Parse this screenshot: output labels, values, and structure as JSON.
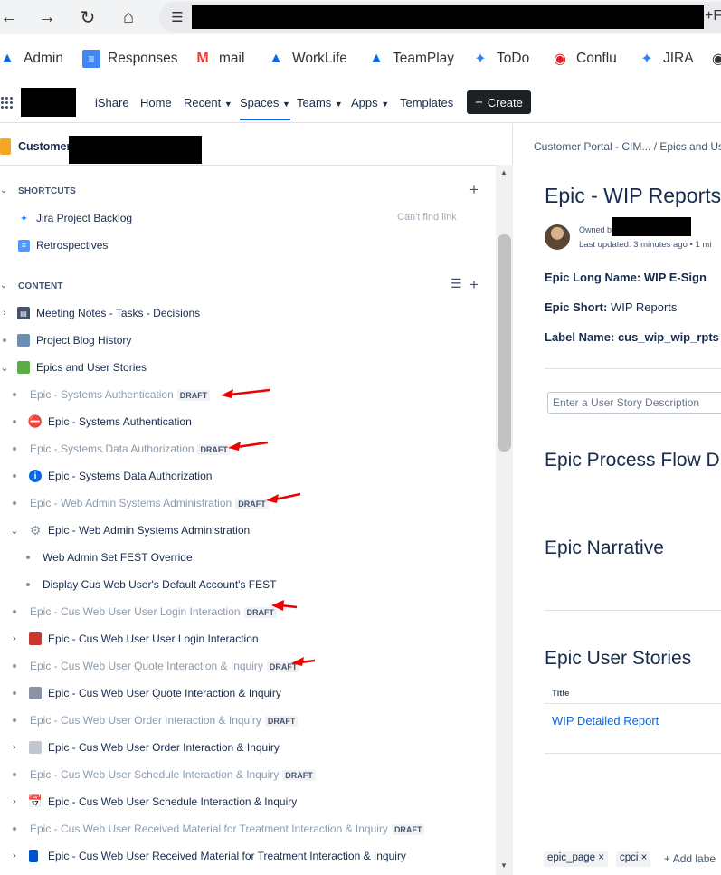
{
  "browser": {
    "address_tail": "+F"
  },
  "bookmarks": [
    {
      "label": "Admin",
      "icon": "atlassian-icon"
    },
    {
      "label": "Responses",
      "icon": "forms-icon"
    },
    {
      "label": "mail",
      "icon": "gmail-icon"
    },
    {
      "label": "WorkLife",
      "icon": "atlassian-icon"
    },
    {
      "label": "TeamPlay",
      "icon": "atlassian-icon"
    },
    {
      "label": "ToDo",
      "icon": "jira-icon"
    },
    {
      "label": "Conflu",
      "icon": "confluence-icon"
    },
    {
      "label": "JIRA",
      "icon": "jira-icon"
    }
  ],
  "topnav": {
    "ishare": "iShare",
    "home": "Home",
    "recent": "Recent",
    "spaces": "Spaces",
    "teams": "Teams",
    "apps": "Apps",
    "templates": "Templates",
    "create": "Create"
  },
  "sidebar": {
    "space_name": "Customer P",
    "shortcuts_label": "SHORTCUTS",
    "shortcuts": [
      {
        "label": "Jira Project Backlog",
        "icon": "jira-icon"
      },
      {
        "label": "Retrospectives",
        "icon": "document-icon"
      }
    ],
    "cant_find": "Can't find link",
    "content_label": "CONTENT",
    "tree": [
      {
        "label": "Meeting Notes - Tasks - Decisions",
        "icon": "notebook-icon",
        "draft": ""
      },
      {
        "label": "Project Blog History",
        "icon": "blog-icon",
        "draft": ""
      },
      {
        "label": "Epics and User Stories",
        "icon": "book-icon",
        "draft": ""
      },
      {
        "label": "Epic - Systems Authentication",
        "icon": "",
        "draft": "DRAFT"
      },
      {
        "label": "Epic - Systems Authentication",
        "icon": "no-entry-icon",
        "draft": ""
      },
      {
        "label": "Epic - Systems Data Authorization",
        "icon": "",
        "draft": "DRAFT"
      },
      {
        "label": "Epic - Systems Data Authorization",
        "icon": "info-icon",
        "draft": ""
      },
      {
        "label": "Epic - Web Admin Systems Administration",
        "icon": "",
        "draft": "DRAFT"
      },
      {
        "label": "Epic - Web Admin Systems Administration",
        "icon": "gear-icon",
        "draft": ""
      },
      {
        "label": "Web Admin Set FEST Override",
        "icon": "",
        "draft": ""
      },
      {
        "label": "Display Cus Web User's Default Account's FEST",
        "icon": "",
        "draft": ""
      },
      {
        "label": "Epic - Cus Web User User Login Interaction",
        "icon": "",
        "draft": "DRAFT"
      },
      {
        "label": "Epic - Cus Web User User Login Interaction",
        "icon": "inbox-icon",
        "draft": ""
      },
      {
        "label": "Epic - Cus Web User Quote Interaction & Inquiry",
        "icon": "",
        "draft": "DRAFT"
      },
      {
        "label": "Epic - Cus Web User Quote Interaction & Inquiry",
        "icon": "document-icon",
        "draft": ""
      },
      {
        "label": "Epic - Cus Web User Order Interaction & Inquiry",
        "icon": "",
        "draft": "DRAFT"
      },
      {
        "label": "Epic - Cus Web User Order Interaction & Inquiry",
        "icon": "page-icon",
        "draft": ""
      },
      {
        "label": "Epic - Cus Web User Schedule Interaction & Inquiry",
        "icon": "",
        "draft": "DRAFT"
      },
      {
        "label": "Epic - Cus Web User Schedule Interaction & Inquiry",
        "icon": "calendar-icon",
        "draft": ""
      },
      {
        "label": "Epic - Cus Web User Received Material for Treatment Interaction & Inquiry",
        "icon": "",
        "draft": "DRAFT"
      },
      {
        "label": "Epic - Cus Web User Received Material for Treatment Interaction & Inquiry",
        "icon": "book-icon",
        "draft": ""
      }
    ]
  },
  "main": {
    "breadcrumb": "Customer Portal - CIM...  /  Epics and Us",
    "title": "Epic - WIP Reports",
    "owned_by": "Owned b",
    "updated": "Last updated: 3 minutes ago  •  1 mi",
    "epic_long_label": "Epic Long Name:",
    "epic_long_value": "WIP E-Sign",
    "epic_short_label": "Epic Short:",
    "epic_short_value": "WIP Reports",
    "label_name_label": "Label Name:",
    "label_name_value": "cus_wip_wip_rpts",
    "story_placeholder": "Enter a User Story Description",
    "process_flow_heading": "Epic Process Flow D",
    "narrative_heading": "Epic Narrative",
    "user_stories_heading": "Epic User Stories",
    "table_title_header": "Title",
    "table_link": "WIP Detailed Report",
    "labels": [
      "epic_page",
      "cpci"
    ],
    "add_label": "Add labe"
  }
}
